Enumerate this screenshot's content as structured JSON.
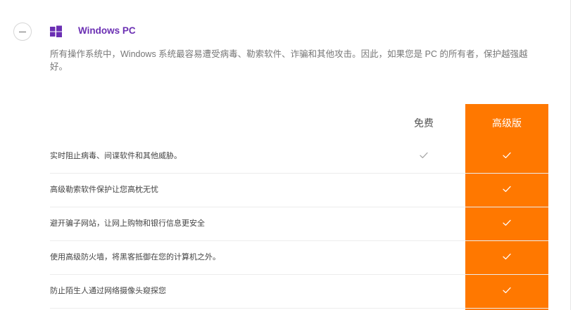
{
  "section": {
    "title": "Windows PC",
    "description": "所有操作系统中，Windows 系统最容易遭受病毒、勒索软件、诈骗和其他攻击。因此，如果您是 PC 的所有者，保护越强越好。"
  },
  "columns": {
    "free": "免费",
    "premium": "高级版"
  },
  "colors": {
    "accent": "#6b2fb3",
    "premium": "#ff7800"
  },
  "features": [
    {
      "label": "实时阻止病毒、间谍软件和其他威胁。",
      "free": true,
      "premium": true
    },
    {
      "label": "高级勒索软件保护让您高枕无忧",
      "free": false,
      "premium": true
    },
    {
      "label": "避开骗子网站，让网上购物和银行信息更安全",
      "free": false,
      "premium": true
    },
    {
      "label": "使用高级防火墙，将黑客抵御在您的计算机之外。",
      "free": false,
      "premium": true
    },
    {
      "label": "防止陌生人通过网络摄像头窥探您",
      "free": false,
      "premium": true
    }
  ]
}
